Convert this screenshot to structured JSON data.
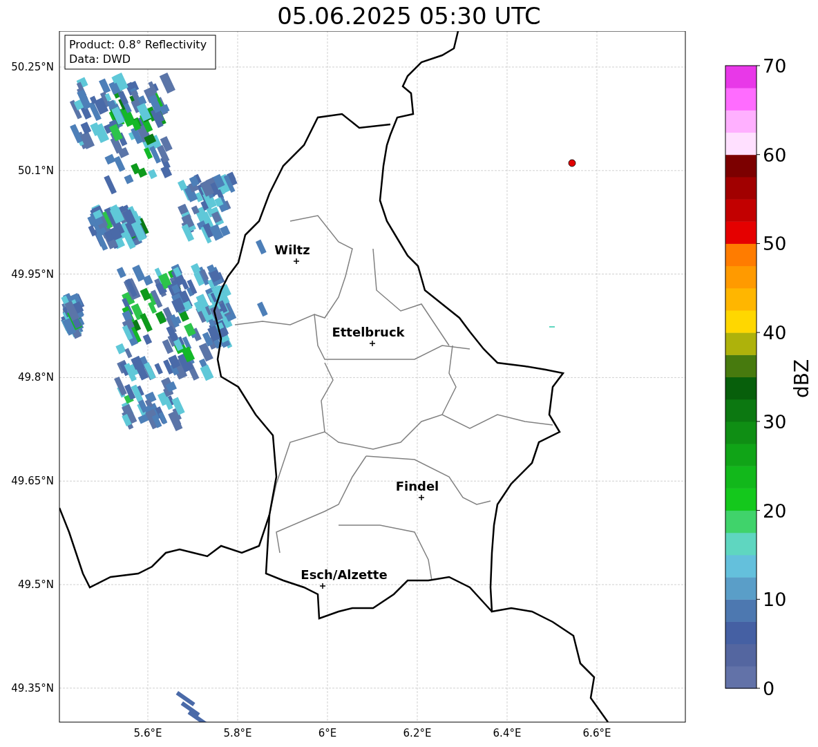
{
  "title": "05.06.2025 05:30 UTC",
  "info_box": [
    "Product: 0.8° Reflectivity",
    "Data: DWD"
  ],
  "map": {
    "lat_ticks": [
      "50.25°N",
      "50.1°N",
      "49.95°N",
      "49.8°N",
      "49.65°N",
      "49.5°N",
      "49.35°N"
    ],
    "lon_ticks": [
      "5.6°E",
      "5.8°E",
      "6°E",
      "6.2°E",
      "6.4°E",
      "6.6°E"
    ],
    "cities": [
      {
        "name": "Wiltz"
      },
      {
        "name": "Ettelbruck"
      },
      {
        "name": "Findel"
      },
      {
        "name": "Esch/Alzette"
      }
    ]
  },
  "colorbar": {
    "label": "dBZ",
    "ticks": [
      "70",
      "60",
      "50",
      "40",
      "30",
      "20",
      "10",
      "0"
    ],
    "bins": [
      {
        "color": "#6272a8"
      },
      {
        "color": "#5466a0"
      },
      {
        "color": "#4560a3"
      },
      {
        "color": "#4d78b0"
      },
      {
        "color": "#5a9ec8"
      },
      {
        "color": "#64c0dc"
      },
      {
        "color": "#5fd6c0"
      },
      {
        "color": "#40d36b"
      },
      {
        "color": "#14c81c"
      },
      {
        "color": "#12b81b"
      },
      {
        "color": "#10a417"
      },
      {
        "color": "#0f8e14"
      },
      {
        "color": "#0c7811"
      },
      {
        "color": "#075f0b"
      },
      {
        "color": "#477a0e"
      },
      {
        "color": "#aeb20b"
      },
      {
        "color": "#ffd700"
      },
      {
        "color": "#ffb600"
      },
      {
        "color": "#ff9a00"
      },
      {
        "color": "#ff7c00"
      },
      {
        "color": "#e50000"
      },
      {
        "color": "#c20000"
      },
      {
        "color": "#a10000"
      },
      {
        "color": "#7c0000"
      },
      {
        "color": "#ffe0ff"
      },
      {
        "color": "#ffb0ff"
      },
      {
        "color": "#ff6cff"
      },
      {
        "color": "#e838e8"
      }
    ]
  }
}
